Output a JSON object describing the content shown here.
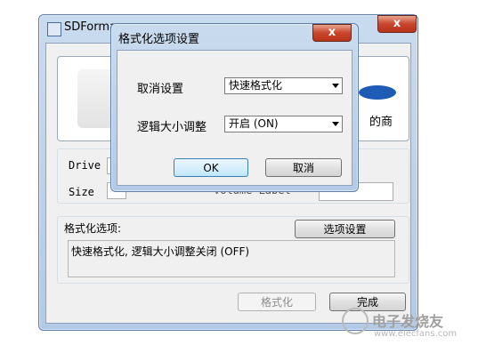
{
  "main_window": {
    "title": "SDFormatter",
    "title_visible": "SDForma",
    "close_glyph": "x",
    "brand_partial": "的商",
    "drive_label": "Drive",
    "size_label": "Size",
    "volume_label_partial": "Volume Label",
    "format_options_heading": "格式化选项:",
    "option_settings_button": "选项设置",
    "options_summary": "快速格式化, 逻辑大小调整关闭 (OFF)",
    "format_button": "格式化",
    "finish_button": "完成"
  },
  "dialog": {
    "title": "格式化选项设置",
    "close_glyph": "x",
    "cancel_setting_label": "取消设置",
    "cancel_setting_value": "快速格式化",
    "logical_size_label": "逻辑大小调整",
    "logical_size_value": "开启 (ON)",
    "ok_button": "OK",
    "cancel_button": "取消"
  },
  "watermark": {
    "brand_text": "电子发烧友",
    "url_text": "www.elecfans.com"
  },
  "colors": {
    "accent_blue": "#1e5bb5",
    "close_red": "#c9452b",
    "watermark_gray": "#b8b8b8"
  }
}
